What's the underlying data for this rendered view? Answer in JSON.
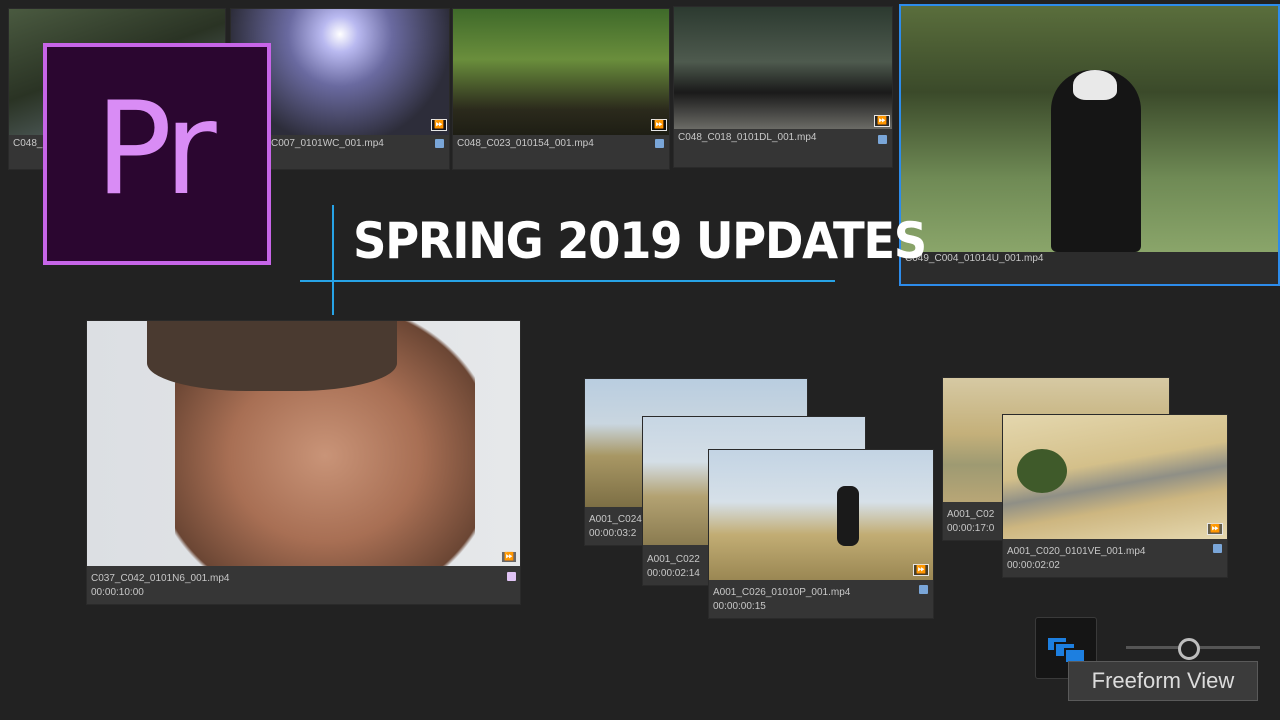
{
  "brand": {
    "logo_text": "Pr",
    "logo_color": "#c765e8"
  },
  "headline": "SPRING 2019 UPDATES",
  "accent_color": "#27a3e6",
  "selected_color": "#2d8ceb",
  "clips": {
    "top1": {
      "name": "C048_",
      "label_color": "#7aa6d8"
    },
    "top2": {
      "name": "C007_0101WC_001.mp4",
      "label_color": "#7aa6d8"
    },
    "top3": {
      "name": "C048_C023_010154_001.mp4",
      "label_color": "#7aa6d8"
    },
    "top4": {
      "name": "C048_C018_0101DL_001.mp4",
      "label_color": "#7aa6d8"
    },
    "top5": {
      "name": "C049_C004_01014U_001.mp4"
    },
    "face": {
      "name": "C037_C042_0101N6_001.mp4",
      "duration": "00:00:10:00",
      "label_color": "#e0c4f5"
    },
    "s1": {
      "name": "A001_C024",
      "duration": "00:00:03:2"
    },
    "s2": {
      "name": "A001_C022",
      "duration": "00:00:02:14"
    },
    "s3": {
      "name": "A001_C026_01010P_001.mp4",
      "duration": "00:00:00:15",
      "label_color": "#7aa6d8"
    },
    "r1": {
      "name": "A001_C02",
      "duration": "00:00:17:0"
    },
    "r2": {
      "name": "A001_C020_0101VE_001.mp4",
      "duration": "00:00:02:02",
      "label_color": "#7aa6d8"
    }
  },
  "badge_glyph": "⏩",
  "freeform": {
    "tooltip": "Freeform View",
    "icon": "freeform-view-icon"
  }
}
